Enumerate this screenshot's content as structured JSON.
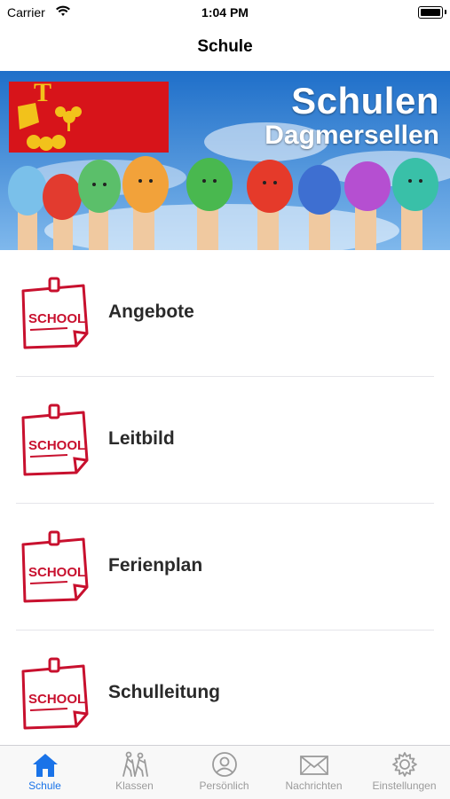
{
  "status_bar": {
    "carrier": "Carrier",
    "time": "1:04 PM"
  },
  "nav": {
    "title": "Schule"
  },
  "banner": {
    "title": "Schulen",
    "subtitle": "Dagmersellen",
    "flag_letter": "T"
  },
  "list": {
    "icon_text": "SCHOOL",
    "items": [
      {
        "label": "Angebote"
      },
      {
        "label": "Leitbild"
      },
      {
        "label": "Ferienplan"
      },
      {
        "label": "Schulleitung"
      }
    ]
  },
  "tabbar": {
    "tabs": [
      {
        "label": "Schule",
        "icon": "house-icon",
        "active": true
      },
      {
        "label": "Klassen",
        "icon": "hiking-people-icon",
        "active": false
      },
      {
        "label": "Persönlich",
        "icon": "person-circle-icon",
        "active": false
      },
      {
        "label": "Nachrichten",
        "icon": "envelope-icon",
        "active": false
      },
      {
        "label": "Einstellungen",
        "icon": "gear-icon",
        "active": false
      }
    ]
  },
  "colors": {
    "accent": "#1a73e8",
    "inactive": "#9b9b9b",
    "school_red": "#c8102e",
    "flag_red": "#d7141a",
    "flag_gold": "#f2c21b",
    "sky": "#2f86d9"
  }
}
